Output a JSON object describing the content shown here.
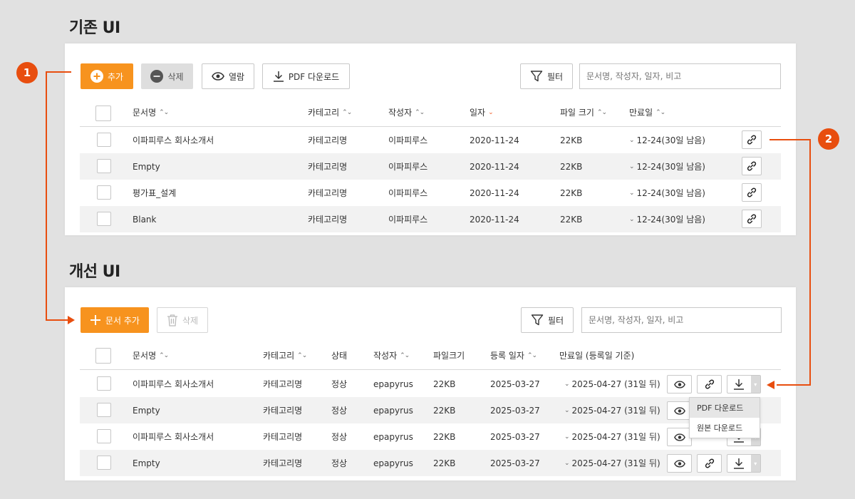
{
  "sections": {
    "legacy_title": "기존 UI",
    "improved_title": "개선 UI"
  },
  "legacy": {
    "toolbar": {
      "add_label": "추가",
      "delete_label": "삭제",
      "view_label": "열람",
      "pdf_label": "PDF 다운로드",
      "filter_label": "필터",
      "search_placeholder": "문서명, 작성자, 일자, 비고"
    },
    "columns": [
      "문서명",
      "카테고리",
      "작성자",
      "일자",
      "파일 크기",
      "만료일"
    ],
    "rows": [
      {
        "name": "이파피루스 회사소개서",
        "category": "카테고리명",
        "author": "이파피루스",
        "date": "2020-11-24",
        "size": "22KB",
        "expiry": "12-24(30일 남음)"
      },
      {
        "name": "Empty",
        "category": "카테고리명",
        "author": "이파피루스",
        "date": "2020-11-24",
        "size": "22KB",
        "expiry": "12-24(30일 남음)"
      },
      {
        "name": "평가표_설계",
        "category": "카테고리명",
        "author": "이파피루스",
        "date": "2020-11-24",
        "size": "22KB",
        "expiry": "12-24(30일 남음)"
      },
      {
        "name": "Blank",
        "category": "카테고리명",
        "author": "이파피루스",
        "date": "2020-11-24",
        "size": "22KB",
        "expiry": "12-24(30일 남음)"
      }
    ]
  },
  "improved": {
    "toolbar": {
      "add_label": "문서 추가",
      "delete_label": "삭제",
      "filter_label": "필터",
      "search_placeholder": "문서명, 작성자, 일자, 비고"
    },
    "columns": [
      "문서명",
      "카테고리",
      "상태",
      "작성자",
      "파일크기",
      "등록 일자",
      "만료일 (등록일 기준)"
    ],
    "rows": [
      {
        "name": "이파피루스 회사소개서",
        "category": "카테고리명",
        "status": "정상",
        "author": "epapyrus",
        "size": "22KB",
        "date": "2025-03-27",
        "expiry": "2025-04-27 (31일 뒤)"
      },
      {
        "name": "Empty",
        "category": "카테고리명",
        "status": "정상",
        "author": "epapyrus",
        "size": "22KB",
        "date": "2025-03-27",
        "expiry": "2025-04-27 (31일 뒤)"
      },
      {
        "name": "이파피루스 회사소개서",
        "category": "카테고리명",
        "status": "정상",
        "author": "epapyrus",
        "size": "22KB",
        "date": "2025-03-27",
        "expiry": "2025-04-27 (31일 뒤)"
      },
      {
        "name": "Empty",
        "category": "카테고리명",
        "status": "정상",
        "author": "epapyrus",
        "size": "22KB",
        "date": "2025-03-27",
        "expiry": "2025-04-27 (31일 뒤)"
      }
    ],
    "download_menu": [
      "PDF 다운로드",
      "원본 다운로드"
    ]
  },
  "annotations": {
    "badge_1": "1",
    "badge_2": "2",
    "accent_color": "#e84e0f"
  },
  "colors": {
    "primary": "#f7931e",
    "active_sort": "#f15a22",
    "row_alt": "#f2f2f2"
  }
}
